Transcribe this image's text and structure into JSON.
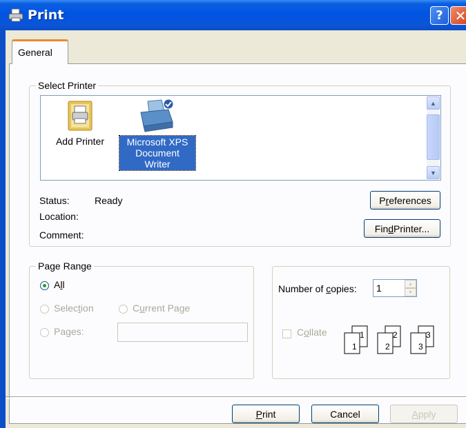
{
  "window": {
    "title": "Print",
    "help_label": "?",
    "close_label": "✕"
  },
  "tabs": [
    {
      "label": "General"
    }
  ],
  "select_printer": {
    "legend": "Select Printer",
    "printers": [
      {
        "label_lines": [
          "Add Printer"
        ],
        "icon": "add-printer-icon",
        "selected": false
      },
      {
        "label_lines": [
          "Microsoft XPS",
          "Document",
          "Writer"
        ],
        "icon": "printer-icon",
        "selected": true
      }
    ],
    "status_label": "Status:",
    "status_value": "Ready",
    "location_label": "Location:",
    "comment_label": "Comment:",
    "preferences_button": {
      "pre": "P",
      "ul": "r",
      "post": "eferences"
    },
    "find_printer_button": {
      "pre": "Fin",
      "ul": "d",
      "post": " Printer..."
    }
  },
  "page_range": {
    "legend": "Page Range",
    "all": {
      "pre": "A",
      "ul": "l",
      "post": "l",
      "checked": true
    },
    "selection": {
      "pre": "Selec",
      "ul": "t",
      "post": "ion",
      "enabled": false
    },
    "current_page": {
      "pre": "C",
      "ul": "u",
      "post": "rrent Page",
      "enabled": false
    },
    "pages": {
      "pre": "Pa",
      "ul": "g",
      "post": "es:",
      "enabled": false,
      "value": ""
    }
  },
  "copies": {
    "number_label": {
      "pre": "Number of ",
      "ul": "c",
      "post": "opies:"
    },
    "number_value": "1",
    "collate": {
      "pre": "C",
      "ul": "o",
      "post": "llate",
      "checked": false,
      "enabled": false
    },
    "collate_pages": [
      "1",
      "1",
      "2",
      "2",
      "3",
      "3"
    ]
  },
  "footer": {
    "print_button": {
      "pre": "",
      "ul": "P",
      "post": "rint"
    },
    "cancel_button": "Cancel",
    "apply_button": {
      "pre": "",
      "ul": "A",
      "post": "pply"
    }
  },
  "colors": {
    "titlebar": "#0054e3",
    "selection": "#316ac5",
    "face": "#ece9d8",
    "tab_accent": "#e68b2c"
  }
}
